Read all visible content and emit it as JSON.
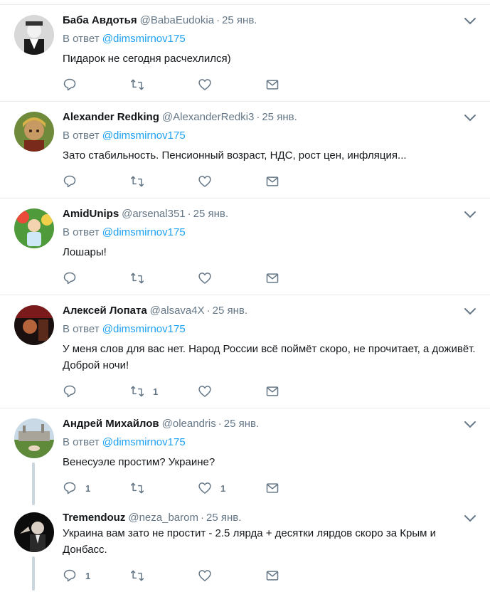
{
  "reply_prefix": "В ответ",
  "tweets": [
    {
      "fullname": "Баба Авдотья",
      "username": "@BabaEudokia",
      "dot": "·",
      "time": "25 янв.",
      "reply_to": "@dimsmirnov175",
      "text": "Пидарок не сегодня расчехлился)",
      "reply_count": "",
      "retweet_count": "",
      "like_count": ""
    },
    {
      "fullname": "Alexander Redking",
      "username": "@AlexanderRedki3",
      "dot": "·",
      "time": "25 янв.",
      "reply_to": "@dimsmirnov175",
      "text": "Зато стабильность. Пенсионный возраст, НДС, рост цен, инфляция...",
      "reply_count": "",
      "retweet_count": "",
      "like_count": ""
    },
    {
      "fullname": "AmidUnips",
      "username": "@arsenal351",
      "dot": "·",
      "time": "25 янв.",
      "reply_to": "@dimsmirnov175",
      "text": "Лошары!",
      "reply_count": "",
      "retweet_count": "",
      "like_count": ""
    },
    {
      "fullname": "Алексей Лопата",
      "username": "@alsava4X",
      "dot": "·",
      "time": "25 янв.",
      "reply_to": "@dimsmirnov175",
      "text": "У меня слов для вас нет. Народ России всё поймёт скоро, не прочитает, а доживёт. Доброй ночи!",
      "reply_count": "",
      "retweet_count": "1",
      "like_count": ""
    },
    {
      "fullname": "Андрей Михайлов",
      "username": "@oleandris",
      "dot": "·",
      "time": "25 янв.",
      "reply_to": "@dimsmirnov175",
      "text": "Венесуэле простим? Украине?",
      "reply_count": "1",
      "retweet_count": "",
      "like_count": "1"
    },
    {
      "fullname": "Tremendouz",
      "username": "@neza_barom",
      "dot": "·",
      "time": "25 янв.",
      "reply_to": "",
      "text": "Украина вам зато не простит - 2.5 лярда + десятки лярдов скоро за Крым и Донбасс.",
      "reply_count": "1",
      "retweet_count": "",
      "like_count": ""
    }
  ],
  "colors": {
    "link": "#1da1f2",
    "muted": "#657786",
    "text": "#14171a",
    "divider": "#e6ecf0",
    "thread_line": "#ccd6dd"
  },
  "icons": {
    "reply": "reply-icon",
    "retweet": "retweet-icon",
    "like": "heart-icon",
    "dm": "envelope-icon",
    "more": "chevron-down-icon"
  }
}
